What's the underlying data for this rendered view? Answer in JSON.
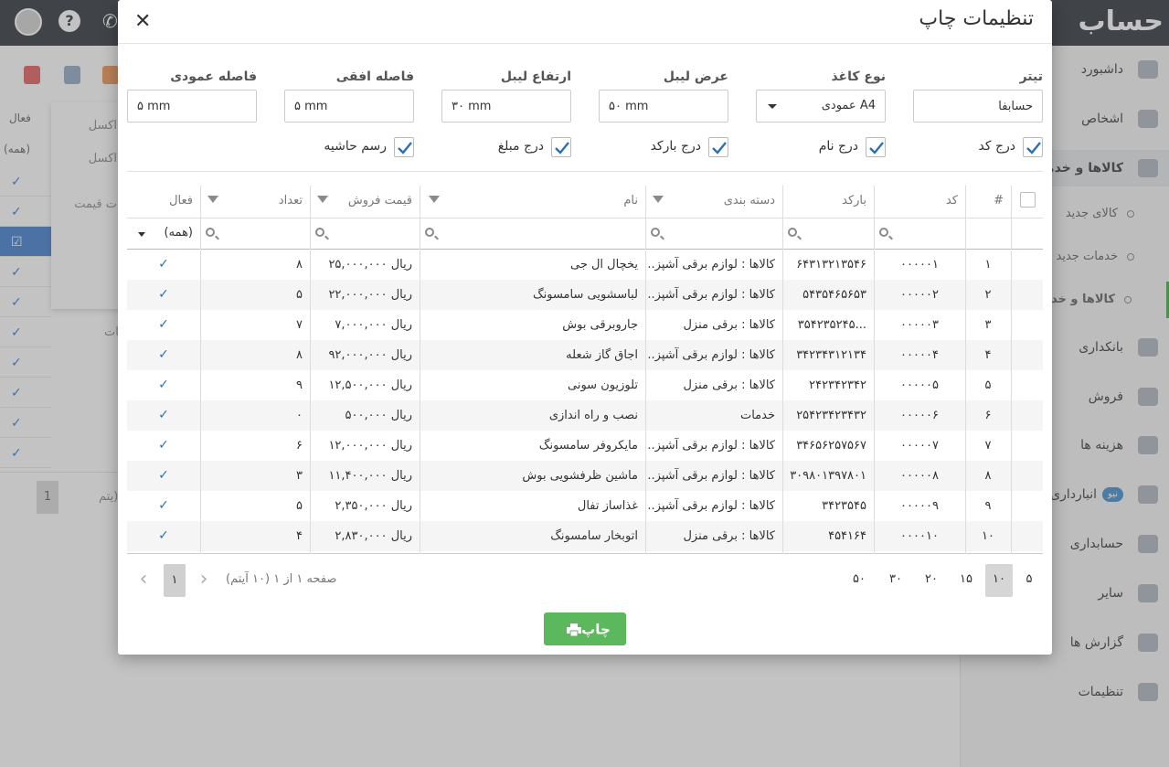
{
  "app": {
    "logo": "حساب"
  },
  "sidebar": {
    "items": [
      {
        "label": "داشبورد",
        "icon": "dashboard-icon"
      },
      {
        "label": "اشخاص",
        "icon": "people-icon"
      },
      {
        "label": "کالاها و خدمات",
        "icon": "box-icon"
      },
      {
        "label": "کالای جدید",
        "icon": "circle-icon"
      },
      {
        "label": "خدمات جدید",
        "icon": "circle-icon"
      },
      {
        "label": "کالاها و خدمات",
        "icon": "circle-icon"
      },
      {
        "label": "بانکداری",
        "icon": "bank-icon"
      },
      {
        "label": "فروش",
        "icon": "sale-icon"
      },
      {
        "label": "هزینه ها",
        "icon": "expense-icon"
      },
      {
        "label": "انبارداری",
        "icon": "warehouse-icon",
        "badge": "نیو"
      },
      {
        "label": "حسابداری",
        "icon": "accounting-icon"
      },
      {
        "label": "سایر",
        "icon": "other-icon"
      },
      {
        "label": "گزارش ها",
        "icon": "report-icon"
      },
      {
        "label": "تنظیمات",
        "icon": "settings-icon"
      }
    ]
  },
  "background": {
    "column_header": "فعال",
    "filter_all": "(همه)",
    "menu": [
      "اکسل",
      "اکسل",
      "ت قیمت"
    ],
    "text_fragment": "یات",
    "pager_text": "یتم)",
    "page": "1"
  },
  "modal": {
    "title": "تنظیمات چاپ",
    "close": "✕",
    "fields": {
      "title_label": "تیتر",
      "title_value": "حسابفا",
      "paper_label": "نوع کاغذ",
      "paper_value": "A4 عمودی",
      "label_width_label": "عرض لیبل",
      "label_width_value": "۵۰ mm",
      "label_height_label": "ارتفاع لیبل",
      "label_height_value": "۳۰ mm",
      "h_gap_label": "فاصله افقی",
      "h_gap_value": "۵ mm",
      "v_gap_label": "فاصله عمودی",
      "v_gap_value": "۵ mm"
    },
    "checkboxes": [
      {
        "label": "درج کد",
        "checked": true
      },
      {
        "label": "درج نام",
        "checked": true
      },
      {
        "label": "درج بارکد",
        "checked": true
      },
      {
        "label": "درج مبلغ",
        "checked": true
      },
      {
        "label": "رسم حاشیه",
        "checked": true
      }
    ],
    "grid": {
      "columns": {
        "index": "#",
        "code": "کد",
        "barcode": "بارکد",
        "category": "دسته بندی",
        "name": "نام",
        "price": "قیمت فروش",
        "qty": "تعداد",
        "active": "فعال"
      },
      "filter_all": "(همه)",
      "rows": [
        {
          "index": "۱",
          "code": "۰۰۰۰۰۱",
          "barcode": "۶۴۳۱۳۲۱۳۵۴۶",
          "category": "کالاها : لوازم برقی آشپز...",
          "name": "یخچال ال جی",
          "price": "ریال ۲۵,۰۰۰,۰۰۰",
          "qty": "۸",
          "active": "✓"
        },
        {
          "index": "۲",
          "code": "۰۰۰۰۰۲",
          "barcode": "۵۴۳۵۴۶۵۶۵۳",
          "category": "کالاها : لوازم برقی آشپز...",
          "name": "لباسشویی سامسونگ",
          "price": "ریال ۲۲,۰۰۰,۰۰۰",
          "qty": "۵",
          "active": "✓"
        },
        {
          "index": "۳",
          "code": "۰۰۰۰۰۳",
          "barcode": "...۳۵۴۲۳۵۲۴۵",
          "category": "کالاها : برقی منزل",
          "name": "جاروبرقی بوش",
          "price": "ریال ۷,۰۰۰,۰۰۰",
          "qty": "۷",
          "active": "✓"
        },
        {
          "index": "۴",
          "code": "۰۰۰۰۰۴",
          "barcode": "۳۴۲۳۴۳۱۲۱۳۴",
          "category": "کالاها : لوازم برقی آشپز...",
          "name": "اجاق گاز شعله",
          "price": "ریال ۹۲,۰۰۰,۰۰۰",
          "qty": "۸",
          "active": "✓"
        },
        {
          "index": "۵",
          "code": "۰۰۰۰۰۵",
          "barcode": "۲۴۲۳۴۲۳۴۲",
          "category": "کالاها : برقی منزل",
          "name": "تلوزیون سونی",
          "price": "ریال ۱۲,۵۰۰,۰۰۰",
          "qty": "۹",
          "active": "✓"
        },
        {
          "index": "۶",
          "code": "۰۰۰۰۰۶",
          "barcode": "۲۵۴۲۳۴۲۳۴۳۲",
          "category": "خدمات",
          "name": "نصب و راه اندازی",
          "price": "ریال ۵۰۰,۰۰۰",
          "qty": "۰",
          "active": "✓"
        },
        {
          "index": "۷",
          "code": "۰۰۰۰۰۷",
          "barcode": "۳۴۶۵۶۲۵۷۵۶۷",
          "category": "کالاها : لوازم برقی آشپز...",
          "name": "مایکروفر سامسونگ",
          "price": "ریال ۱۲,۰۰۰,۰۰۰",
          "qty": "۶",
          "active": "✓"
        },
        {
          "index": "۸",
          "code": "۰۰۰۰۰۸",
          "barcode": "۳۰۹۸۰۱۳۹۷۸۰۱",
          "category": "کالاها : لوازم برقی آشپز...",
          "name": "ماشین ظرفشویی بوش",
          "price": "ریال ۱۱,۴۰۰,۰۰۰",
          "qty": "۳",
          "active": "✓"
        },
        {
          "index": "۹",
          "code": "۰۰۰۰۰۹",
          "barcode": "۳۴۲۳۵۴۵",
          "category": "کالاها : لوازم برقی آشپز...",
          "name": "غذاساز تفال",
          "price": "ریال ۲,۳۵۰,۰۰۰",
          "qty": "۵",
          "active": "✓"
        },
        {
          "index": "۱۰",
          "code": "۰۰۰۰۱۰",
          "barcode": "۴۵۴۱۶۴",
          "category": "کالاها : برقی منزل",
          "name": "اتوبخار سامسونگ",
          "price": "ریال ۲,۸۳۰,۰۰۰",
          "qty": "۴",
          "active": "✓"
        }
      ]
    },
    "pager": {
      "sizes": [
        "۵",
        "۱۰",
        "۱۵",
        "۲۰",
        "۳۰",
        "۵۰"
      ],
      "active_size": "۱۰",
      "info": "صفحه ۱ از ۱ (۱۰ آیتم)",
      "current_page": "۱",
      "prev": "‹",
      "next": "›"
    },
    "print_label": "چاپ"
  },
  "colors": {
    "topbar": "#4a4f57",
    "accent_green": "#5cb85c",
    "check_blue": "#2a6fb8",
    "logo_accent": "#f2b632"
  }
}
